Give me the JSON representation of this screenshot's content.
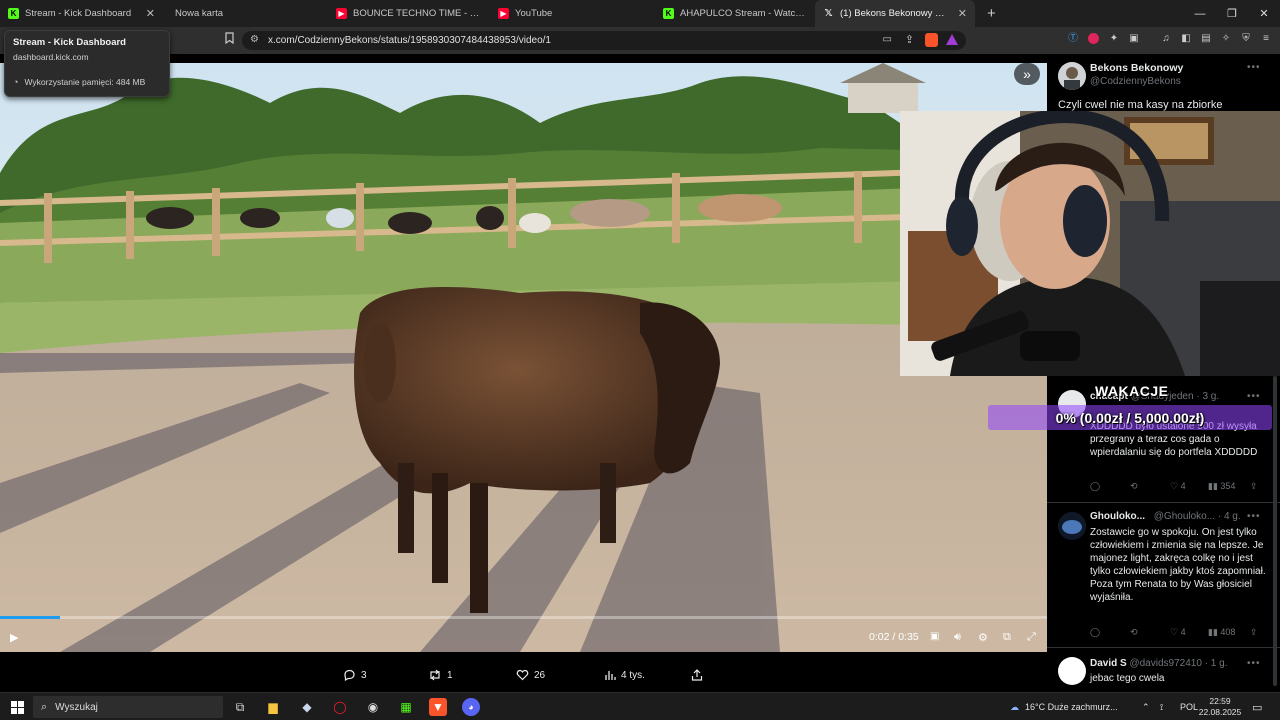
{
  "tabs": [
    {
      "label": "Stream - Kick Dashboard",
      "icon": "kick-icon",
      "active": false
    },
    {
      "label": "Nowa karta",
      "icon": "",
      "active": false
    },
    {
      "label": "BOUNCE TECHNO TIME - YouTube",
      "icon": "youtube-icon",
      "active": false
    },
    {
      "label": "YouTube",
      "icon": "youtube-icon",
      "active": false
    },
    {
      "label": "AHAPULCO Stream - Watch Live on K",
      "icon": "kick-icon",
      "active": false
    },
    {
      "label": "(1) Bekons Bekonowy w serwisie",
      "icon": "x-icon",
      "active": true
    }
  ],
  "tooltip": {
    "title": "Stream - Kick Dashboard",
    "host": "dashboard.kick.com",
    "memory": "Wykorzystanie pamięci: 484 MB"
  },
  "address_bar": {
    "url": "x.com/CodziennyBekons/status/1958930307484438953/video/1"
  },
  "video": {
    "time": "0:02 / 0:35",
    "progress_fraction": 0.057
  },
  "post_actions": {
    "replies": "3",
    "reposts": "1",
    "likes": "26",
    "views": "4 tys."
  },
  "post": {
    "author_name": "Bekons Bekonowy",
    "author_handle": "@CodziennyBekons",
    "text": "Czyli cwel nie ma kasy na zbiorke"
  },
  "replies": [
    {
      "name": "chacapt",
      "handle": "@Shadyjeden",
      "time": "· 3 g.",
      "text": "XDDDDD było ustalone 500 zł wysyła przegrany a teraz cos gada o wpierdalaniu się do portfela XDDDDD",
      "comments": "",
      "reposts": "",
      "likes": "4",
      "views": "354"
    },
    {
      "name": "Ghouloko...",
      "handle": "@Ghouloko...",
      "time": "· 4 g.",
      "text": "Zostawcie go w spokoju. On jest tylko człowiekiem i zmienia się na lepsze. Je majonez light, zakręca colkę no i jest tylko człowiekiem jakby ktoś zapomniał. Poza tym Renata to by Was głosiciel wyjaśniła.",
      "comments": "",
      "reposts": "",
      "likes": "4",
      "views": "408"
    },
    {
      "name": "David S",
      "handle": "@davids972410",
      "time": "· 1 g.",
      "text": "jebac tego cwela"
    }
  ],
  "overlay": {
    "goal_title": "WAKACJE",
    "goal_text": "0% (0.00zł / 5,000.00zł)",
    "goal_fraction": 0
  },
  "taskbar": {
    "search_label": "Wyszukaj",
    "weather": "16°C  Duże zachmurz...",
    "lang": "POL",
    "time": "22:59",
    "date": "22.08.2025"
  },
  "colors": {
    "x_blue": "#1d9bf0",
    "kick_green": "#53fc18",
    "youtube_red": "#ff0033",
    "goal_purple": "#9146ff"
  }
}
